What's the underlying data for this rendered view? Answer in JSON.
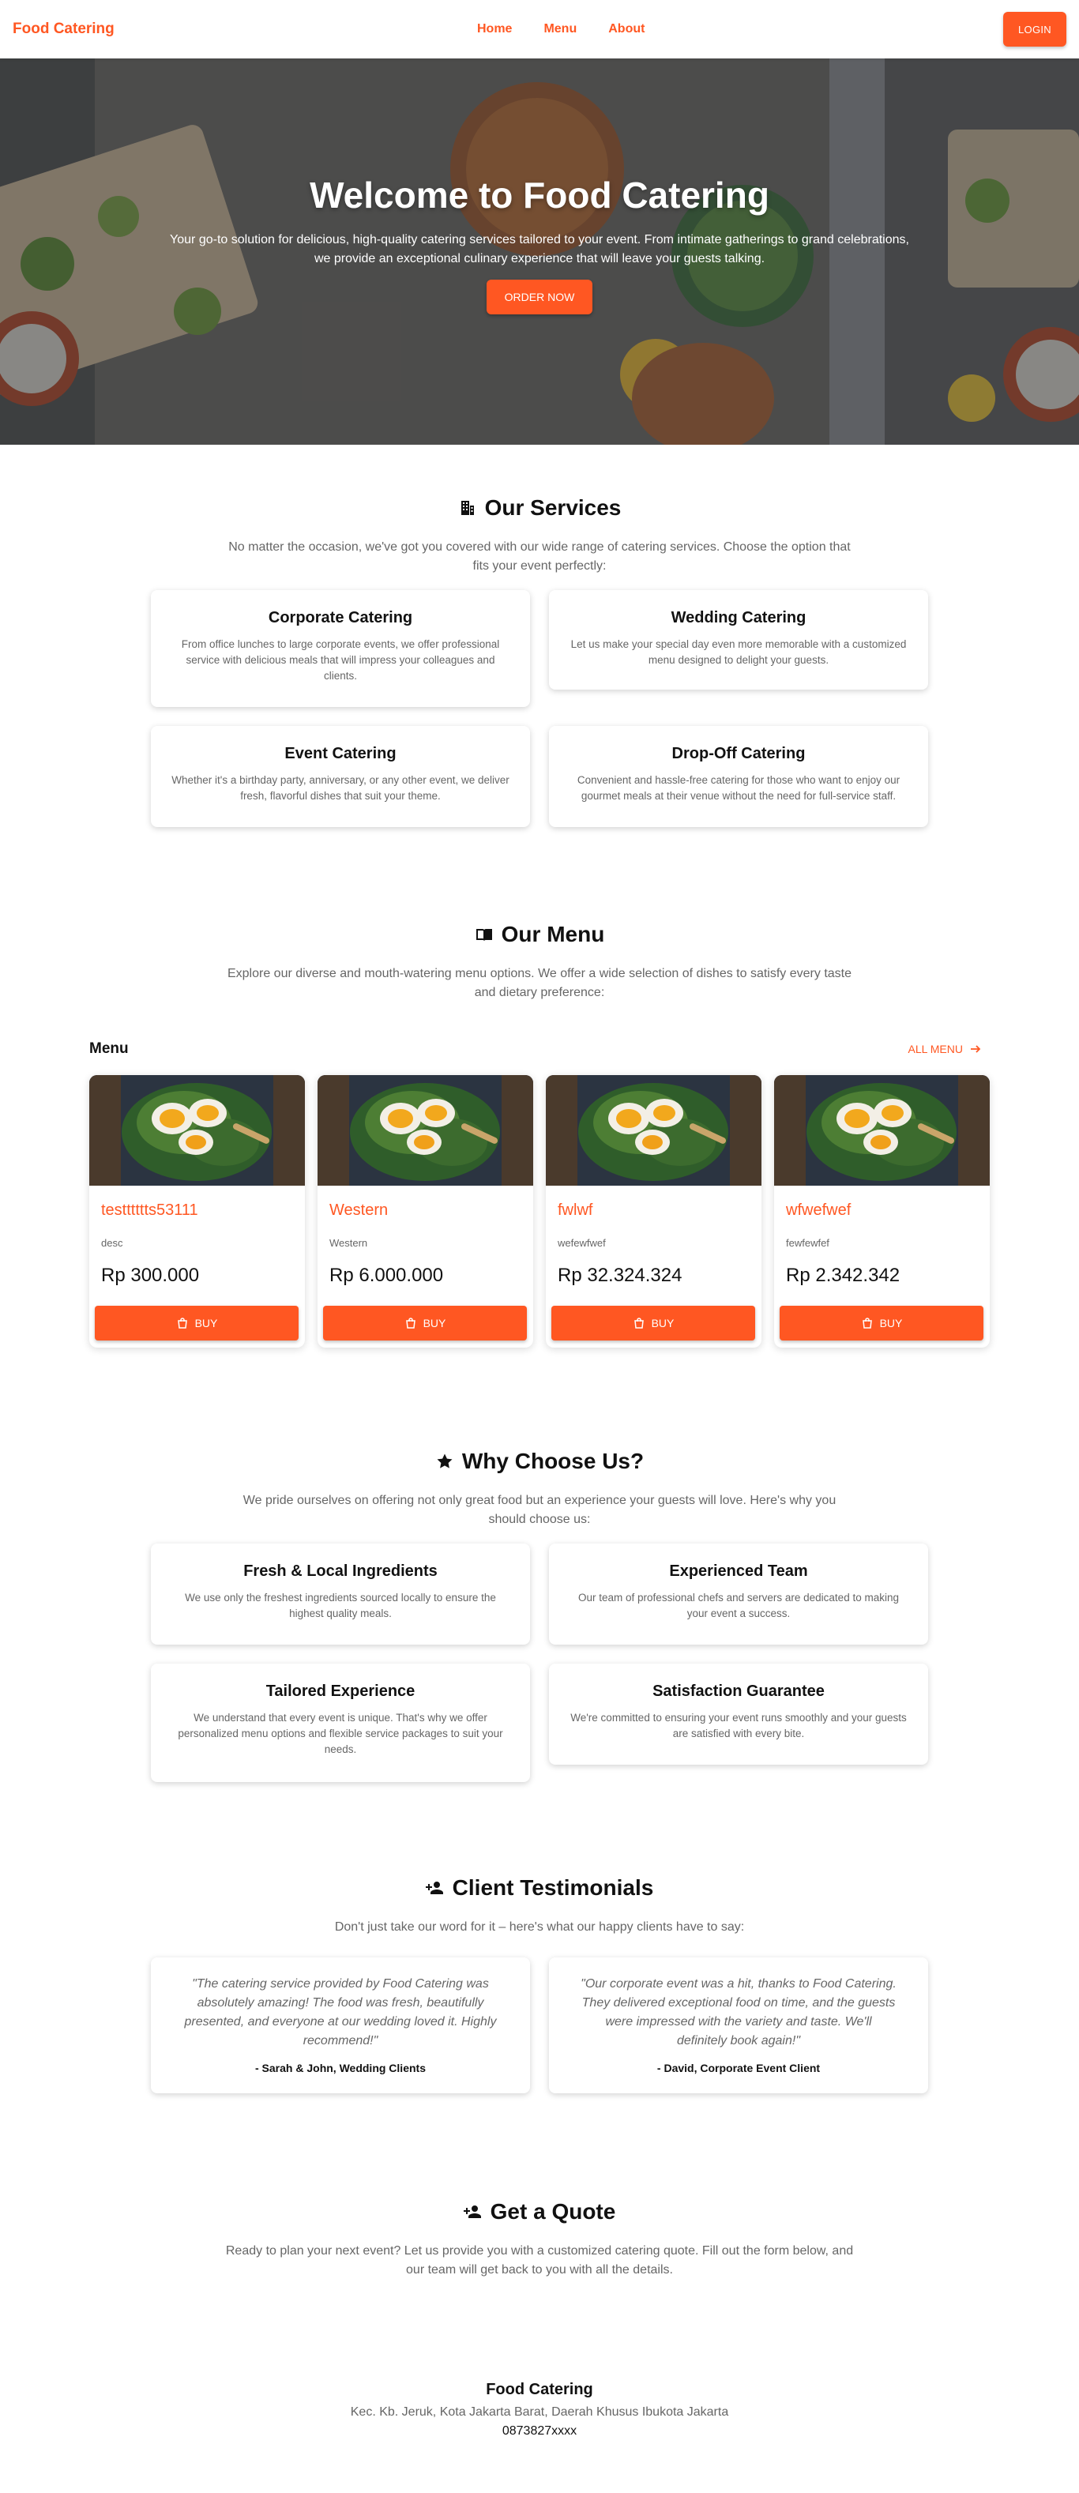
{
  "nav": {
    "brand": "Food Catering",
    "links": [
      "Home",
      "Menu",
      "About"
    ],
    "login": "LOGIN"
  },
  "hero": {
    "title": "Welcome to Food Catering",
    "text": "Your go-to solution for delicious, high-quality catering services tailored to your event. From intimate gatherings to grand celebrations, we provide an exceptional culinary experience that will leave your guests talking.",
    "button": "ORDER NOW"
  },
  "services": {
    "title": "Our Services",
    "desc": "No matter the occasion, we've got you covered with our wide range of catering services. Choose the option that fits your event perfectly:",
    "items": [
      {
        "title": "Corporate Catering",
        "text": "From office lunches to large corporate events, we offer professional service with delicious meals that will impress your colleagues and clients."
      },
      {
        "title": "Wedding Catering",
        "text": "Let us make your special day even more memorable with a customized menu designed to delight your guests."
      },
      {
        "title": "Event Catering",
        "text": "Whether it's a birthday party, anniversary, or any other event, we deliver fresh, flavorful dishes that suit your theme."
      },
      {
        "title": "Drop-Off Catering",
        "text": "Convenient and hassle-free catering for those who want to enjoy our gourmet meals at their venue without the need for full-service staff."
      }
    ]
  },
  "menu": {
    "title": "Our Menu",
    "desc": "Explore our diverse and mouth-watering menu options. We offer a wide selection of dishes to satisfy every taste and dietary preference:",
    "subheading": "Menu",
    "all_menu": "ALL MENU",
    "buy_label": "BUY",
    "items": [
      {
        "name": "testttttts53111",
        "desc": "desc",
        "price": "Rp 300.000"
      },
      {
        "name": "Western",
        "desc": "Western",
        "price": "Rp 6.000.000"
      },
      {
        "name": "fwlwf",
        "desc": "wefewfwef",
        "price": "Rp 32.324.324"
      },
      {
        "name": "wfwefwef",
        "desc": "fewfewfef",
        "price": "Rp 2.342.342"
      }
    ]
  },
  "why": {
    "title": "Why Choose Us?",
    "desc": "We pride ourselves on offering not only great food but an experience your guests will love. Here's why you should choose us:",
    "items": [
      {
        "title": "Fresh & Local Ingredients",
        "text": "We use only the freshest ingredients sourced locally to ensure the highest quality meals."
      },
      {
        "title": "Experienced Team",
        "text": "Our team of professional chefs and servers are dedicated to making your event a success."
      },
      {
        "title": "Tailored Experience",
        "text": "We understand that every event is unique. That's why we offer personalized menu options and flexible service packages to suit your needs."
      },
      {
        "title": "Satisfaction Guarantee",
        "text": "We're committed to ensuring your event runs smoothly and your guests are satisfied with every bite."
      }
    ]
  },
  "testimonials": {
    "title": "Client Testimonials",
    "desc": "Don't just take our word for it – here's what our happy clients have to say:",
    "items": [
      {
        "quote": "\"The catering service provided by Food Catering was absolutely amazing! The food was fresh, beautifully presented, and everyone at our wedding loved it. Highly recommend!\"",
        "author": "- Sarah & John, Wedding Clients"
      },
      {
        "quote": "\"Our corporate event was a hit, thanks to Food Catering. They delivered exceptional food on time, and the guests were impressed with the variety and taste. We'll definitely book again!\"",
        "author": "- David, Corporate Event Client"
      }
    ]
  },
  "quote": {
    "title": "Get a Quote",
    "desc": "Ready to plan your next event? Let us provide you with a customized catering quote. Fill out the form below, and our team will get back to you with all the details."
  },
  "footer": {
    "name": "Food Catering",
    "address": "Kec. Kb. Jeruk, Kota Jakarta Barat, Daerah Khusus Ibukota Jakarta",
    "phone": "0873827xxxx"
  },
  "colors": {
    "accent": "#ff5722",
    "muted_text": "#666666"
  }
}
